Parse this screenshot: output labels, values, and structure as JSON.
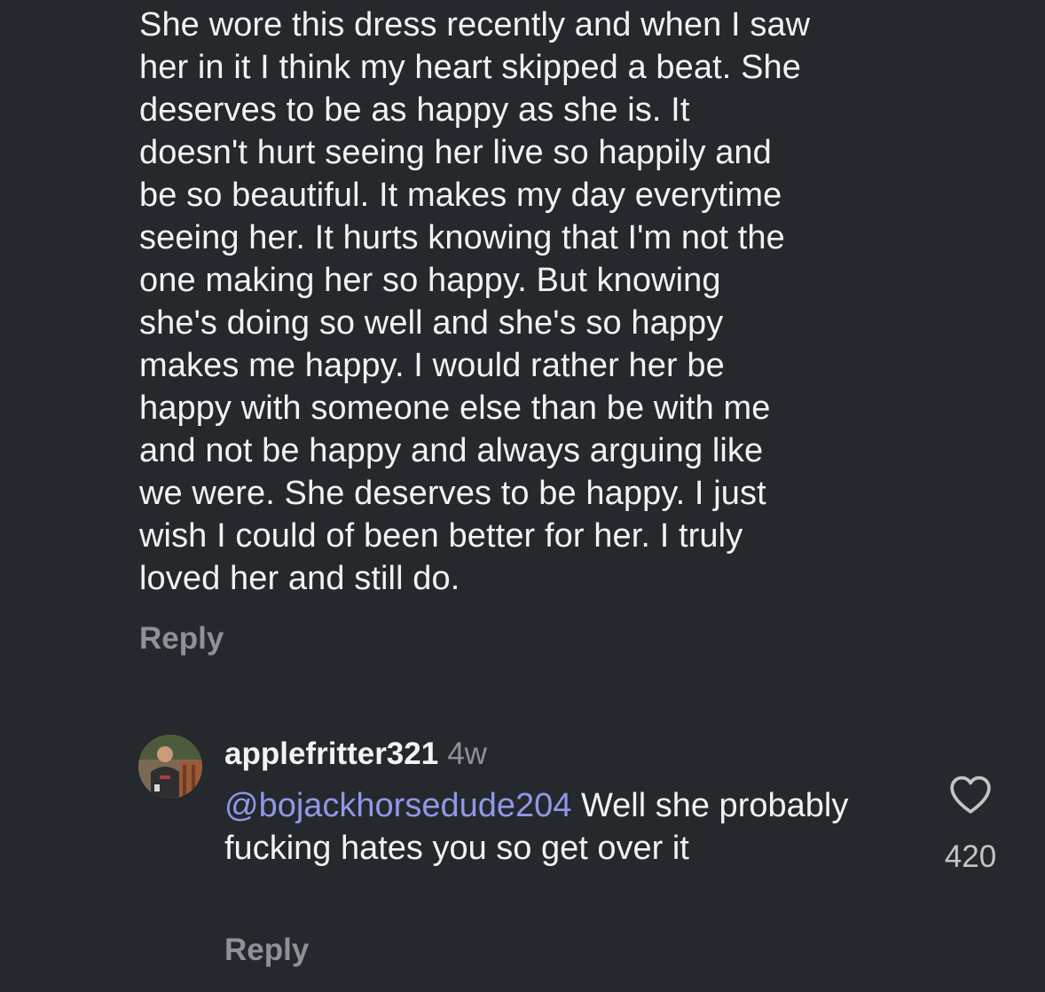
{
  "parent_comment": {
    "text": "She wore this dress recently and when I saw\nher in it I think my heart skipped a beat. She\ndeserves to be as happy as she is. It\ndoesn't hurt seeing her live so happily and\nbe so beautiful. It makes my day everytime\nseeing her. It hurts knowing that I'm not the\none making her so happy. But knowing\nshe's doing so well and she's so happy\nmakes me happy. I would rather her be\nhappy with someone else than be with me\nand not be happy and always arguing like\nwe were. She deserves to be happy. I just\nwish I could of been better for her. I truly\nloved her and still do.",
    "reply_label": "Reply"
  },
  "reply_comment": {
    "username": "applefritter321",
    "time": "4w",
    "mention": "@bojackhorsedude204",
    "text": " Well she probably fucking hates you so get over it",
    "reply_label": "Reply",
    "like_count": "420",
    "like_icon": "heart-outline-icon"
  },
  "colors": {
    "background": "#25282c",
    "text": "#f2f2f2",
    "muted": "#8e9196",
    "mention": "#8f98e8"
  }
}
